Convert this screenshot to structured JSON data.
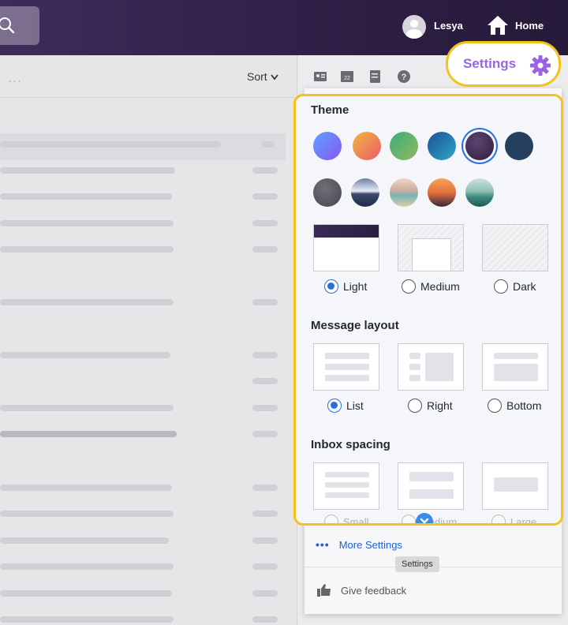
{
  "header": {
    "user_name": "Lesya",
    "home_label": "Home"
  },
  "toolbar": {
    "sort_label": "Sort",
    "overflow_dots": "..."
  },
  "settings_button": {
    "label": "Settings"
  },
  "theme_panel": {
    "theme_title": "Theme",
    "color_swatches": [
      "#7b6bff",
      "#f08a4b",
      "#5bb06e",
      "#1f6fa8",
      "#3a2a4f",
      "#26405f"
    ],
    "selected_swatch_index": 4,
    "photo_swatches": [
      "slate",
      "mountains",
      "lake-boat",
      "sunset-hills",
      "teal-hills"
    ],
    "color_modes": [
      {
        "label": "Light",
        "selected": true
      },
      {
        "label": "Medium",
        "selected": false
      },
      {
        "label": "Dark",
        "selected": false
      }
    ],
    "layout_title": "Message layout",
    "layouts": [
      {
        "label": "List",
        "selected": true
      },
      {
        "label": "Right",
        "selected": false
      },
      {
        "label": "Bottom",
        "selected": false
      }
    ],
    "spacing_title": "Inbox spacing",
    "spacing_options": [
      "Small",
      "Medium",
      "Large"
    ]
  },
  "menu": {
    "more_settings_label": "More Settings",
    "more_settings_dots": "•••",
    "tooltip": "Settings",
    "feedback_label": "Give feedback"
  },
  "colors": {
    "accent": "#9a63e6",
    "highlight": "#f4c21a",
    "link": "#1d5fd8",
    "selection": "#2a6fe0",
    "header_bg": "#2e1f45"
  }
}
